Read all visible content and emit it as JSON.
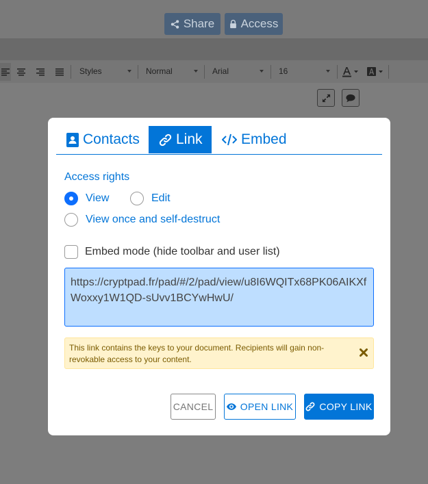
{
  "topbar": {
    "share_label": "Share",
    "access_label": "Access"
  },
  "toolbar": {
    "styles": "Styles",
    "format": "Normal",
    "font": "Arial",
    "size": "16"
  },
  "modal": {
    "tabs": [
      {
        "label": "Contacts",
        "icon": "contacts-icon"
      },
      {
        "label": "Link",
        "icon": "link-icon",
        "active": true
      },
      {
        "label": "Embed",
        "icon": "code-icon"
      }
    ],
    "access_rights_label": "Access rights",
    "options": {
      "view": "View",
      "edit": "Edit",
      "view_once": "View once and self-destruct",
      "selected": "view"
    },
    "embed_mode_label": "Embed mode (hide toolbar and user list)",
    "embed_mode_checked": false,
    "link_url": "https://cryptpad.fr/pad/#/2/pad/view/u8I6WQITx68PK06AIKXfWoxxy1W1QD-sUvv1BCYwHwU/",
    "warning": "This link contains the keys to your document. Recipients will gain non-revokable access to your content.",
    "buttons": {
      "cancel": "CANCEL",
      "open": "OPEN LINK",
      "copy": "COPY LINK"
    }
  },
  "colors": {
    "accent": "#0275d8",
    "link_box_bg": "#bedeff",
    "warning_bg": "#fff3cd",
    "overlay": "#7d7d7d"
  }
}
